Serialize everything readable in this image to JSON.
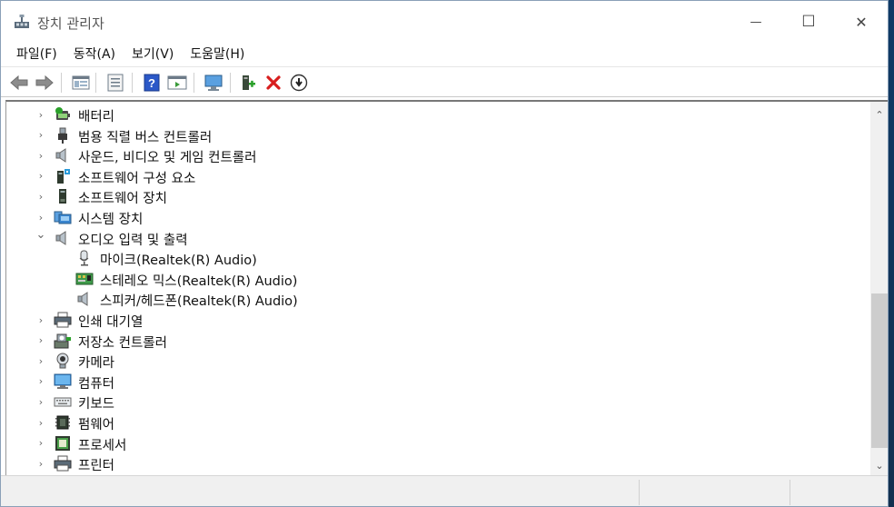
{
  "window": {
    "title": "장치 관리자",
    "minimize_glyph": "—",
    "maximize_glyph": "☐",
    "close_glyph": "✕"
  },
  "menu": [
    {
      "label": "파일(F)"
    },
    {
      "label": "동작(A)"
    },
    {
      "label": "보기(V)"
    },
    {
      "label": "도움말(H)"
    }
  ],
  "toolbar": {
    "buttons": [
      "back-arrow-icon",
      "forward-arrow-icon",
      "properties-pane-icon",
      "properties-sheet-icon",
      "help-icon",
      "action-view-icon",
      "monitor-scan-icon",
      "add-driver-icon",
      "uninstall-icon",
      "update-driver-icon"
    ]
  },
  "tree": {
    "items": [
      {
        "label": "배터리",
        "expanded": false,
        "icon": "battery-icon",
        "level": 0
      },
      {
        "label": "범용 직렬 버스 컨트롤러",
        "expanded": false,
        "icon": "usb-icon",
        "level": 0
      },
      {
        "label": "사운드, 비디오 및 게임 컨트롤러",
        "expanded": false,
        "icon": "speaker-icon",
        "level": 0
      },
      {
        "label": "소프트웨어 구성 요소",
        "expanded": false,
        "icon": "software-component-icon",
        "level": 0
      },
      {
        "label": "소프트웨어 장치",
        "expanded": false,
        "icon": "software-device-icon",
        "level": 0
      },
      {
        "label": "시스템 장치",
        "expanded": false,
        "icon": "system-device-icon",
        "level": 0
      },
      {
        "label": "오디오 입력 및 출력",
        "expanded": true,
        "icon": "speaker-icon",
        "level": 0
      },
      {
        "label": "마이크(Realtek(R) Audio)",
        "icon": "microphone-icon",
        "level": 1
      },
      {
        "label": "스테레오 믹스(Realtek(R) Audio)",
        "icon": "stereo-mix-icon",
        "level": 1
      },
      {
        "label": "스피커/헤드폰(Realtek(R) Audio)",
        "icon": "speaker-icon",
        "level": 1
      },
      {
        "label": "인쇄 대기열",
        "expanded": false,
        "icon": "printer-icon",
        "level": 0
      },
      {
        "label": "저장소 컨트롤러",
        "expanded": false,
        "icon": "storage-controller-icon",
        "level": 0
      },
      {
        "label": "카메라",
        "expanded": false,
        "icon": "camera-icon",
        "level": 0
      },
      {
        "label": "컴퓨터",
        "expanded": false,
        "icon": "computer-icon",
        "level": 0
      },
      {
        "label": "키보드",
        "expanded": false,
        "icon": "keyboard-icon",
        "level": 0
      },
      {
        "label": "펌웨어",
        "expanded": false,
        "icon": "firmware-icon",
        "level": 0
      },
      {
        "label": "프로세서",
        "expanded": false,
        "icon": "processor-icon",
        "level": 0
      },
      {
        "label": "프린터",
        "expanded": false,
        "icon": "printer-icon",
        "level": 0
      }
    ]
  },
  "glyphs": {
    "collapsed": "›",
    "expanded": "⌄",
    "scroll_up": "⌃",
    "scroll_down": "⌄"
  }
}
